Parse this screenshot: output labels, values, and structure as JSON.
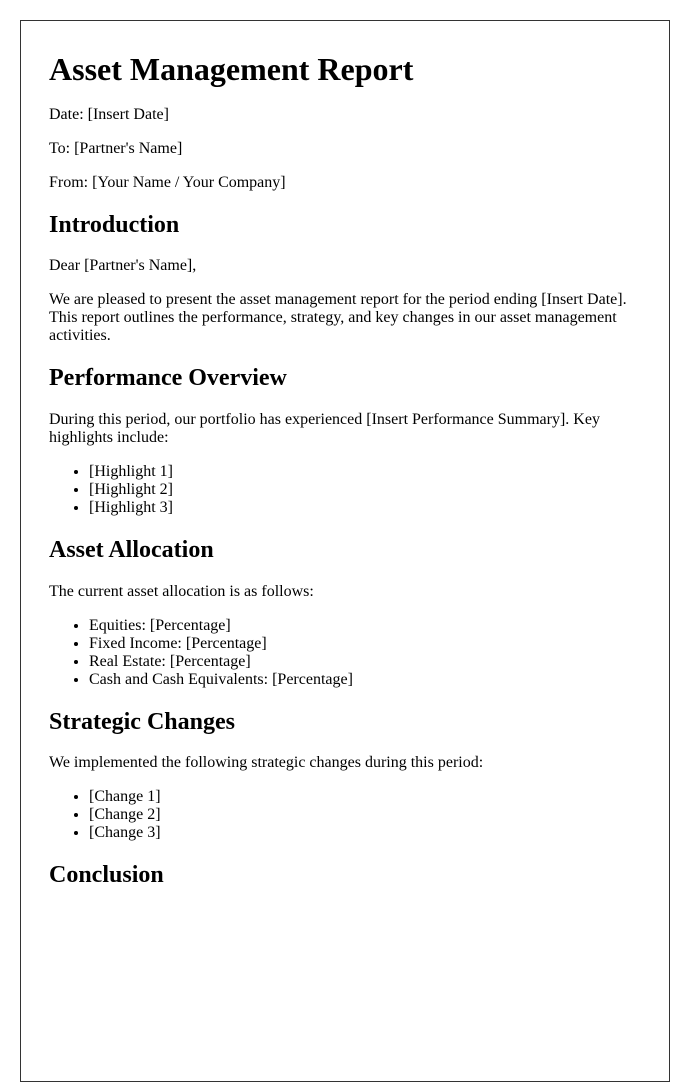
{
  "document": {
    "title": "Asset Management Report",
    "meta": {
      "date": "Date: [Insert Date]",
      "to": "To: [Partner's Name]",
      "from": "From: [Your Name / Your Company]"
    },
    "introduction": {
      "heading": "Introduction",
      "salutation": "Dear [Partner's Name],",
      "body": "We are pleased to present the asset management report for the period ending [Insert Date]. This report outlines the performance, strategy, and key changes in our asset management activities."
    },
    "performance": {
      "heading": "Performance Overview",
      "body": "During this period, our portfolio has experienced [Insert Performance Summary]. Key highlights include:",
      "items": [
        "[Highlight 1]",
        "[Highlight 2]",
        "[Highlight 3]"
      ]
    },
    "allocation": {
      "heading": "Asset Allocation",
      "body": "The current asset allocation is as follows:",
      "items": [
        "Equities: [Percentage]",
        "Fixed Income: [Percentage]",
        "Real Estate: [Percentage]",
        "Cash and Cash Equivalents: [Percentage]"
      ]
    },
    "strategy": {
      "heading": "Strategic Changes",
      "body": "We implemented the following strategic changes during this period:",
      "items": [
        "[Change 1]",
        "[Change 2]",
        "[Change 3]"
      ]
    },
    "conclusion": {
      "heading": "Conclusion"
    }
  }
}
